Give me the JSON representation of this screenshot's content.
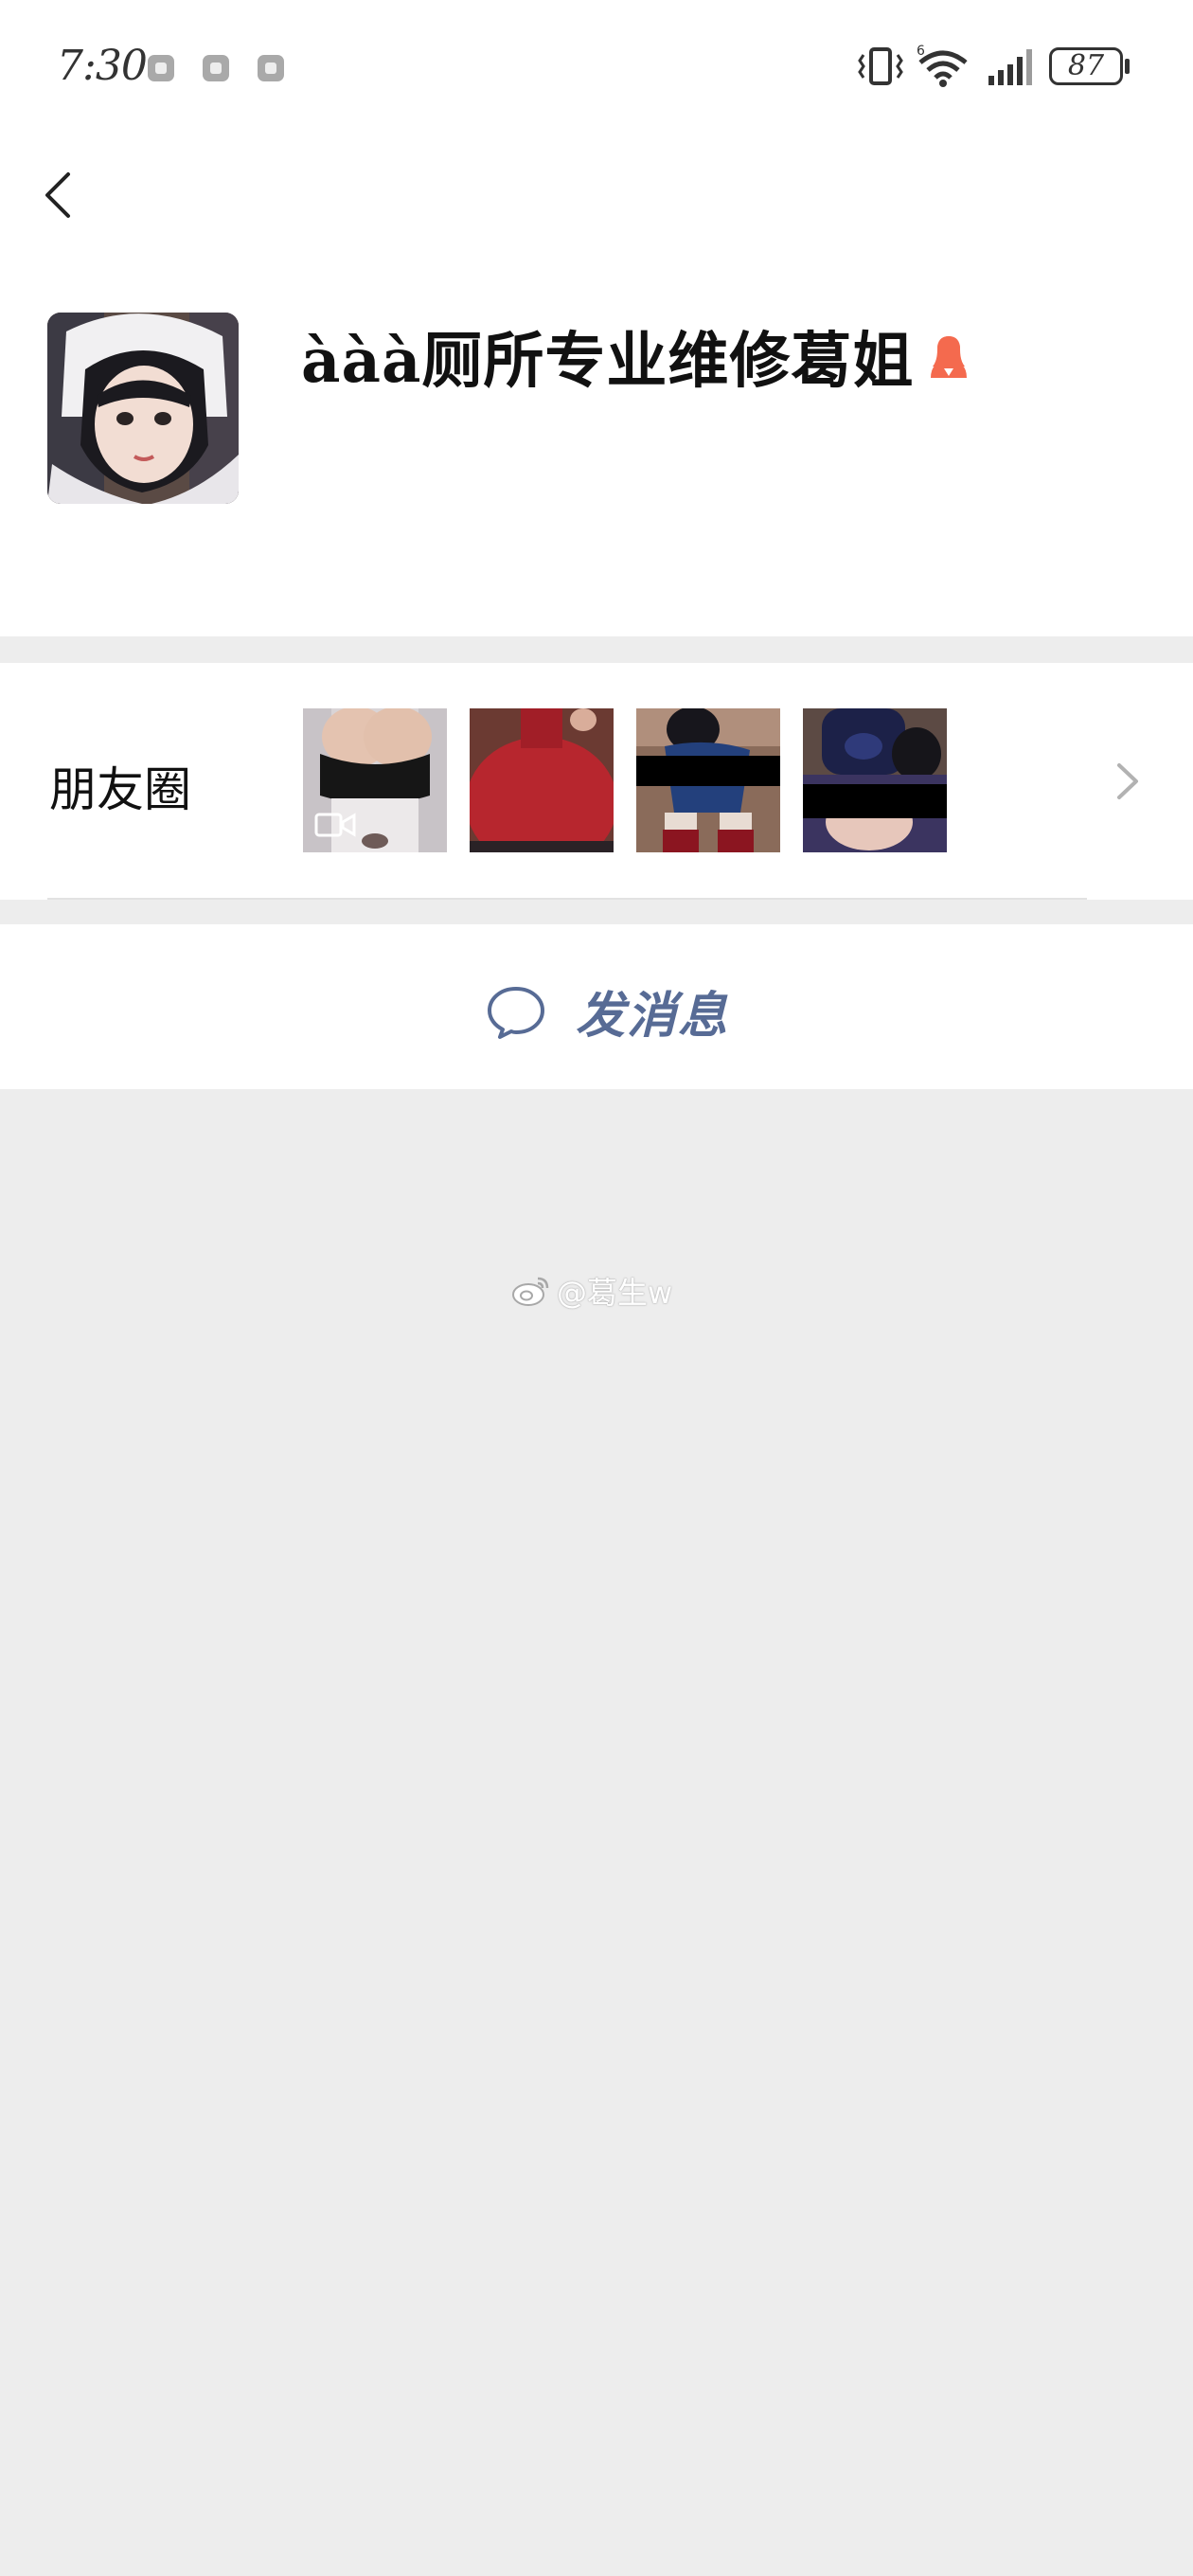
{
  "status_bar": {
    "time": "7:30",
    "battery": "87",
    "network_badge": "6"
  },
  "profile": {
    "display_name": "ààà厕所专业维修葛姐",
    "gender": "female"
  },
  "moments": {
    "label": "朋友圈",
    "thumbnails": [
      {
        "has_video": true
      },
      {
        "has_video": false
      },
      {
        "has_video": false
      },
      {
        "has_video": false
      }
    ]
  },
  "actions": {
    "send_message_label": "发消息"
  },
  "watermark": {
    "text": "@葛生w"
  },
  "colors": {
    "link_blue": "#576b95",
    "female_icon": "#f46a4e",
    "page_bg": "#ededed"
  }
}
